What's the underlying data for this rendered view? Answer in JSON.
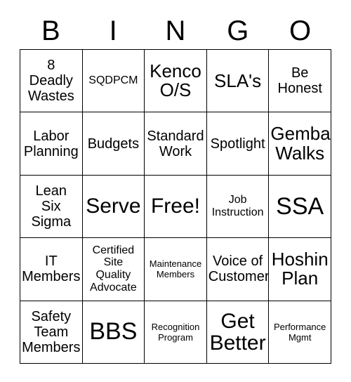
{
  "header": {
    "letters": [
      "B",
      "I",
      "N",
      "G",
      "O"
    ]
  },
  "grid": {
    "rows": 5,
    "columns": 5,
    "border_color": "#000000",
    "background_color": "#ffffff",
    "text_color": "#000000",
    "cells": [
      {
        "text": "8\nDeadly\nWastes",
        "size": "md",
        "free": false
      },
      {
        "text": "SQDPCM",
        "size": "sm",
        "free": false
      },
      {
        "text": "Kenco\nO/S",
        "size": "lg",
        "free": false
      },
      {
        "text": "SLA's",
        "size": "lg",
        "free": false
      },
      {
        "text": "Be\nHonest",
        "size": "md",
        "free": false
      },
      {
        "text": "Labor\nPlanning",
        "size": "md",
        "free": false
      },
      {
        "text": "Budgets",
        "size": "md",
        "free": false
      },
      {
        "text": "Standard\nWork",
        "size": "md",
        "free": false
      },
      {
        "text": "Spotlight",
        "size": "md",
        "free": false
      },
      {
        "text": "Gemba\nWalks",
        "size": "lg",
        "free": false
      },
      {
        "text": "Lean\nSix\nSigma",
        "size": "md",
        "free": false
      },
      {
        "text": "Serve",
        "size": "xl",
        "free": false
      },
      {
        "text": "Free!",
        "size": "xl",
        "free": true
      },
      {
        "text": "Job\nInstruction",
        "size": "sm",
        "free": false
      },
      {
        "text": "SSA",
        "size": "xxl",
        "free": false
      },
      {
        "text": "IT\nMembers",
        "size": "md",
        "free": false
      },
      {
        "text": "Certified\nSite\nQuality\nAdvocate",
        "size": "sm",
        "free": false
      },
      {
        "text": "Maintenance\nMembers",
        "size": "xs",
        "free": false
      },
      {
        "text": "Voice of\nCustomer",
        "size": "md",
        "free": false
      },
      {
        "text": "Hoshin\nPlan",
        "size": "lg",
        "free": false
      },
      {
        "text": "Safety\nTeam\nMembers",
        "size": "md",
        "free": false
      },
      {
        "text": "BBS",
        "size": "xxl",
        "free": false
      },
      {
        "text": "Recognition\nProgram",
        "size": "xs",
        "free": false
      },
      {
        "text": "Get\nBetter",
        "size": "xl",
        "free": false
      },
      {
        "text": "Performance\nMgmt",
        "size": "xs",
        "free": false
      }
    ]
  }
}
